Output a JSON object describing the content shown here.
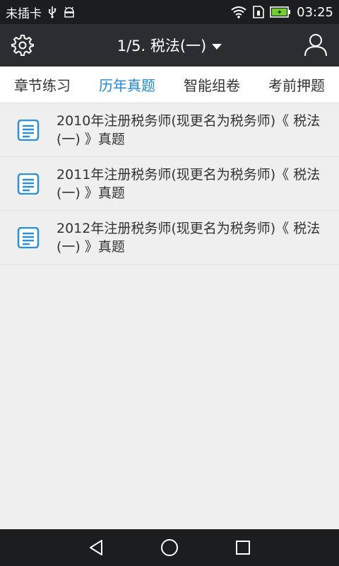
{
  "status_bar": {
    "carrier": "未插卡",
    "usb_icon": "usb-icon",
    "android_icon": "android-debug-icon",
    "wifi_icon": "wifi-icon",
    "sim_icon": "sim-icon",
    "battery_icon": "battery-charging-icon",
    "time": "03:25"
  },
  "header": {
    "settings_icon": "gear-icon",
    "title": "1/5. 税法(一)",
    "dropdown_icon": "caret-down-icon",
    "user_icon": "user-icon"
  },
  "tabs": [
    {
      "label": "章节练习",
      "active": false
    },
    {
      "label": "历年真题",
      "active": true
    },
    {
      "label": "智能组卷",
      "active": false
    },
    {
      "label": "考前押题",
      "active": false
    }
  ],
  "list": [
    {
      "title": "2010年注册税务师(现更名为税务师)《 税法(一) 》真题",
      "icon": "document-icon"
    },
    {
      "title": "2011年注册税务师(现更名为税务师)《 税法(一) 》真题",
      "icon": "document-icon"
    },
    {
      "title": "2012年注册税务师(现更名为税务师)《 税法(一) 》真题",
      "icon": "document-icon"
    }
  ],
  "nav_bar": {
    "back_icon": "back-triangle-icon",
    "home_icon": "home-circle-icon",
    "recents_icon": "recents-square-icon"
  },
  "colors": {
    "accent": "#1e88d8",
    "header_bg": "#2b2d30",
    "status_bg": "#1c1d1f",
    "battery_green": "#6dd22d"
  }
}
